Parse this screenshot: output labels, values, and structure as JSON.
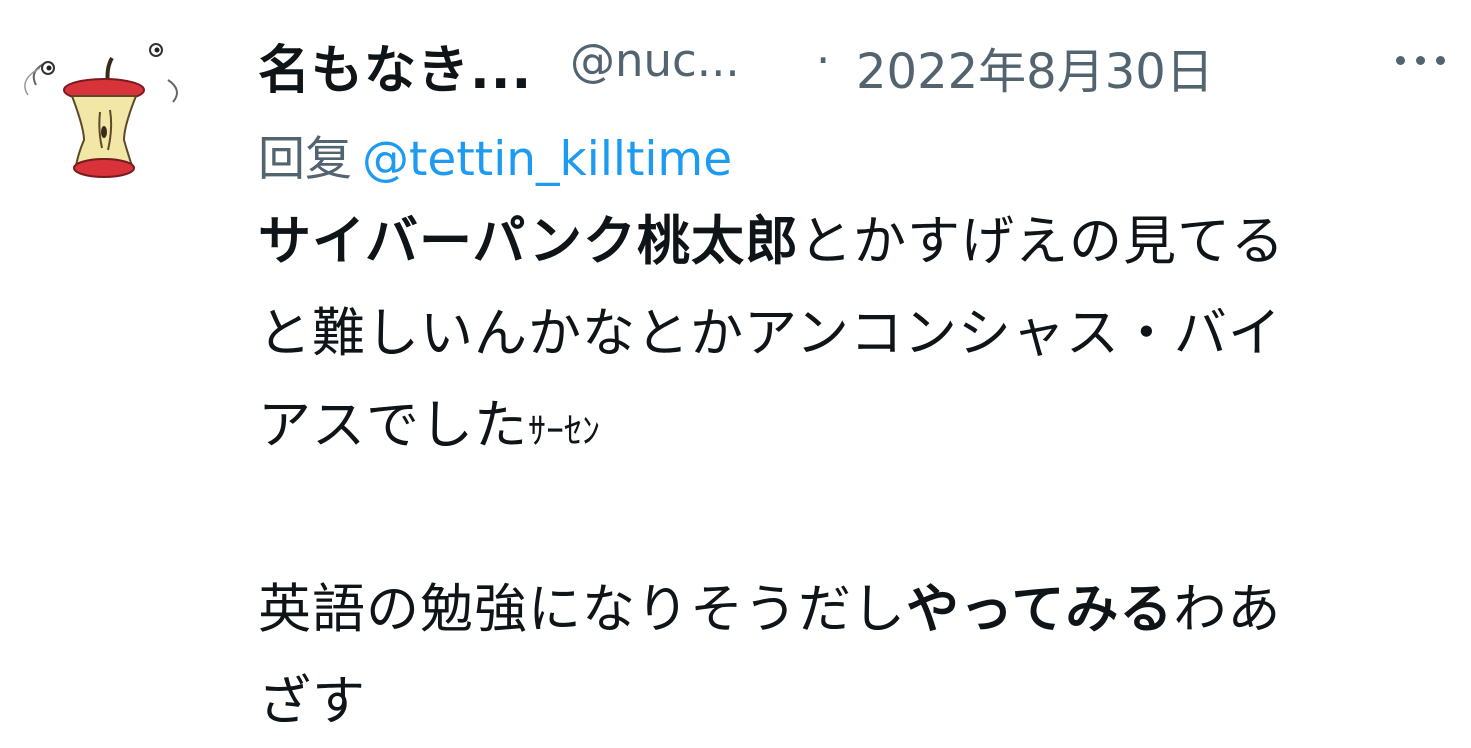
{
  "tweet": {
    "display_name": "名もなき...",
    "handle": "@nuc...",
    "separator": "·",
    "timestamp": "2022年8月30日",
    "more_icon": "more-horizontal-icon",
    "reply_prefix": "回复",
    "reply_to": "@tettin_killtime",
    "body": {
      "l1_bold": "サイバーパンク桃太郎",
      "l1_rest": "とかすげえの見てる",
      "l2": "と難しいんかなとかアンコンシャス・バイ",
      "l3_main": "アスでした",
      "l3_small": "ｻｰｾﾝ",
      "l4_a": "英語の勉強になりそうだし",
      "l4_bold": "やってみる",
      "l4_b": "わあ",
      "l5": "ざす"
    }
  },
  "colors": {
    "primary_text": "#0f1419",
    "secondary_text": "#536471",
    "link": "#1d9bf0"
  }
}
